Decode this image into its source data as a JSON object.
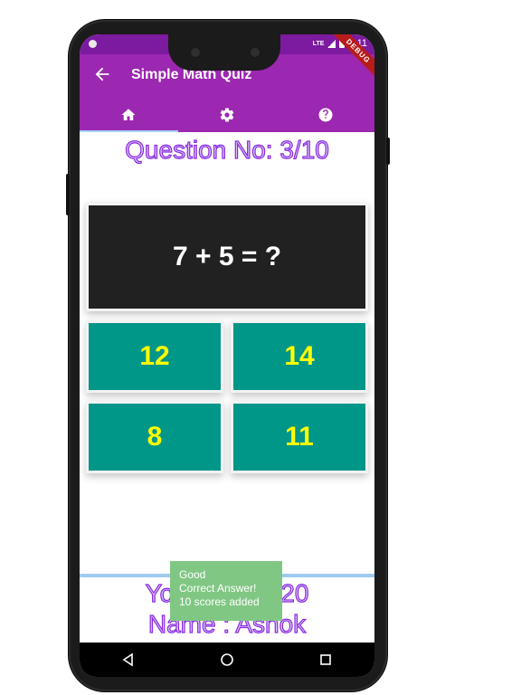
{
  "status_bar": {
    "network": "LTE",
    "time": "2:11",
    "debug_banner": "DEBUG"
  },
  "app_bar": {
    "title": "Simple Math Quiz",
    "back_icon": "arrow-left-icon"
  },
  "tabs": [
    {
      "icon": "home-icon",
      "active": true
    },
    {
      "icon": "gear-icon",
      "active": false
    },
    {
      "icon": "help-icon",
      "active": false
    }
  ],
  "quiz": {
    "question_number": "Question No: 3/10",
    "question": "7 + 5 = ?",
    "options": [
      "12",
      "14",
      "8",
      "11"
    ]
  },
  "footer": {
    "score_left": "Yo",
    "score_right": "20",
    "name": "Name : Ashok"
  },
  "toast": {
    "line1": "Good",
    "line2": "Correct Answer!",
    "line3": "10 scores added"
  },
  "colors": {
    "app_bar": "#9c27b0",
    "question_bg": "#212121",
    "option_bg": "#009688",
    "option_text": "#ffff00",
    "toast_bg": "#81c784"
  }
}
